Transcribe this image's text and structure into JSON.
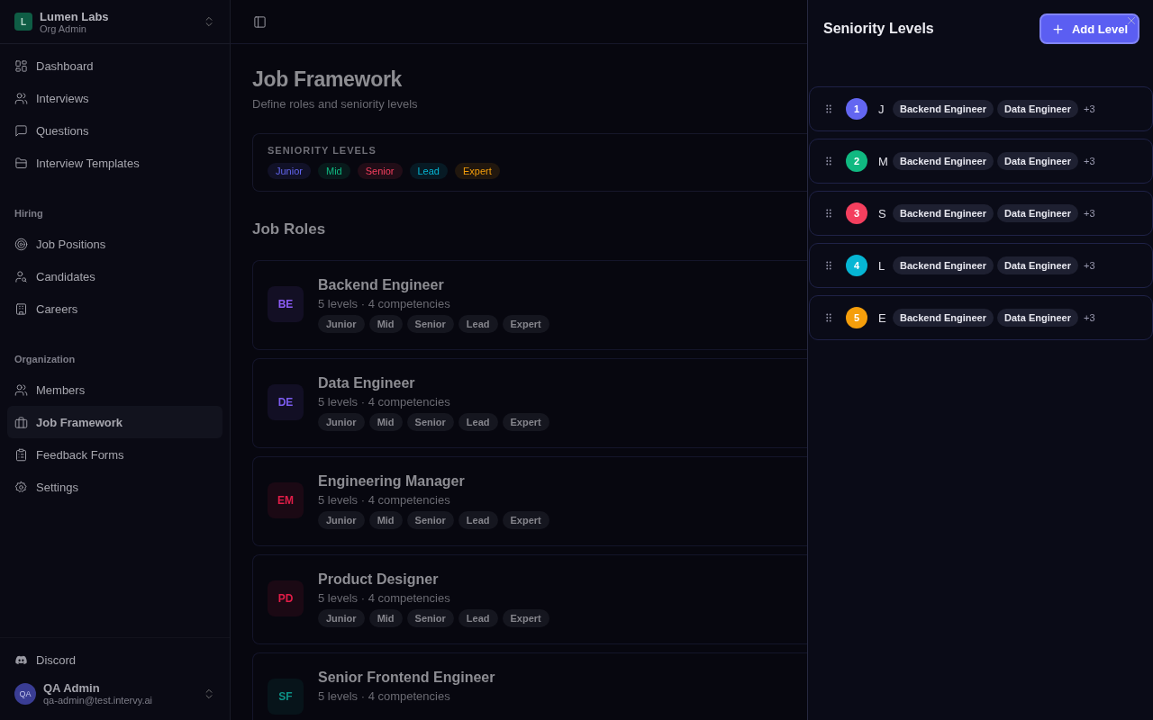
{
  "org": {
    "initial": "L",
    "name": "Lumen Labs",
    "role": "Org Admin"
  },
  "sidebar": {
    "groups": [
      {
        "items": [
          {
            "label": "Dashboard",
            "selected": false
          },
          {
            "label": "Interviews",
            "selected": false
          },
          {
            "label": "Questions",
            "selected": false
          },
          {
            "label": "Interview Templates",
            "selected": false
          }
        ]
      },
      {
        "title": "Hiring",
        "items": [
          {
            "label": "Job Positions",
            "selected": false
          },
          {
            "label": "Candidates",
            "selected": false
          },
          {
            "label": "Careers",
            "selected": false
          }
        ]
      },
      {
        "title": "Organization",
        "items": [
          {
            "label": "Members",
            "selected": false
          },
          {
            "label": "Job Framework",
            "selected": true
          },
          {
            "label": "Feedback Forms",
            "selected": false
          },
          {
            "label": "Settings",
            "selected": false
          }
        ]
      }
    ],
    "footer_link": "Discord",
    "user": {
      "initials": "QA",
      "name": "QA Admin",
      "email": "qa-admin@test.intervy.ai"
    }
  },
  "page": {
    "title": "Job Framework",
    "subtitle": "Define roles and seniority levels",
    "seniority": {
      "heading": "SENIORITY LEVELS",
      "levels": [
        {
          "label": "Junior",
          "color": "#6366f1"
        },
        {
          "label": "Mid",
          "color": "#10b981"
        },
        {
          "label": "Senior",
          "color": "#f43f5e"
        },
        {
          "label": "Lead",
          "color": "#06b6d4"
        },
        {
          "label": "Expert",
          "color": "#f59e0b"
        }
      ]
    },
    "roles_heading": "Job Roles",
    "roles": [
      {
        "initials": "BE",
        "color": "#8b5cf6",
        "name": "Backend Engineer",
        "meta": "5 levels · 4 competencies",
        "tags": [
          "Junior",
          "Mid",
          "Senior",
          "Lead",
          "Expert"
        ]
      },
      {
        "initials": "DE",
        "color": "#7c5cf0",
        "name": "Data Engineer",
        "meta": "5 levels · 4 competencies",
        "tags": [
          "Junior",
          "Mid",
          "Senior",
          "Lead",
          "Expert"
        ]
      },
      {
        "initials": "EM",
        "color": "#e11d48",
        "name": "Engineering Manager",
        "meta": "5 levels · 4 competencies",
        "tags": [
          "Junior",
          "Mid",
          "Senior",
          "Lead",
          "Expert"
        ]
      },
      {
        "initials": "PD",
        "color": "#e11d48",
        "name": "Product Designer",
        "meta": "5 levels · 4 competencies",
        "tags": [
          "Junior",
          "Mid",
          "Senior",
          "Lead",
          "Expert"
        ]
      },
      {
        "initials": "SF",
        "color": "#0d9488",
        "name": "Senior Frontend Engineer",
        "meta": "5 levels · 4 competencies"
      }
    ]
  },
  "drawer": {
    "title": "Seniority Levels",
    "add_button": "Add Level",
    "levels": [
      {
        "number": "1",
        "color": "#6366f1",
        "name": "J",
        "tags": [
          "Backend Engineer",
          "Data Engineer"
        ],
        "more": "+3"
      },
      {
        "number": "2",
        "color": "#10b981",
        "name": "M",
        "tags": [
          "Backend Engineer",
          "Data Engineer"
        ],
        "more": "+3"
      },
      {
        "number": "3",
        "color": "#f43f5e",
        "name": "S",
        "tags": [
          "Backend Engineer",
          "Data Engineer"
        ],
        "more": "+3"
      },
      {
        "number": "4",
        "color": "#06b6d4",
        "name": "L",
        "tags": [
          "Backend Engineer",
          "Data Engineer"
        ],
        "more": "+3"
      },
      {
        "number": "5",
        "color": "#f59e0b",
        "name": "E",
        "tags": [
          "Backend Engineer",
          "Data Engineer"
        ],
        "more": "+3"
      }
    ]
  }
}
